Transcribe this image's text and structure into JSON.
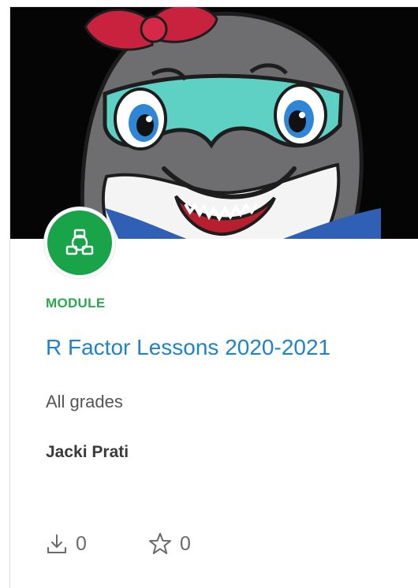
{
  "card": {
    "type_label": "MODULE",
    "title": "R Factor Lessons 2020-2021",
    "grades": "All grades",
    "author": "Jacki Prati",
    "downloads": {
      "icon": "download-icon",
      "count": "0"
    },
    "favorites": {
      "icon": "star-icon",
      "count": "0"
    },
    "type_icon": "module-icon",
    "colors": {
      "accent_green": "#1aa44a",
      "type_label": "#2ea84f",
      "title_link": "#1f83c9"
    }
  }
}
